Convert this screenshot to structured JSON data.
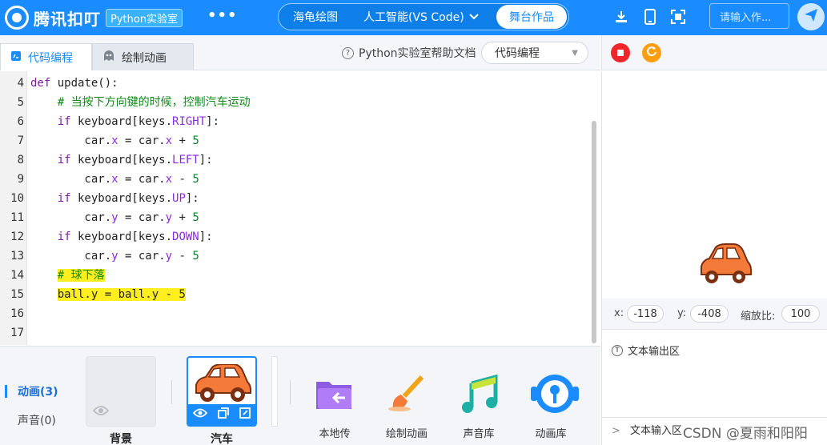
{
  "app": {
    "logo_text": "腾讯扣叮",
    "badge": "Python实验室",
    "more": "•••"
  },
  "mode_tabs": [
    {
      "label": "海龟绘图"
    },
    {
      "label": "人工智能(VS Code)"
    },
    {
      "label": "舞台作品"
    }
  ],
  "search": {
    "placeholder": "请输入作..."
  },
  "editor_tabs": {
    "code_tab": "代码编程",
    "draw_tab": "绘制动画",
    "help_link": "Python实验室帮助文档",
    "mode_select": "代码编程"
  },
  "code_lines": [
    {
      "n": "4",
      "tokens": [
        [
          "kw",
          "def"
        ],
        [
          "plain",
          " update():"
        ]
      ]
    },
    {
      "n": "5",
      "tokens": [
        [
          "cm",
          "    # 当按下方向键的时候，控制汽车运动"
        ]
      ]
    },
    {
      "n": "6",
      "tokens": [
        [
          "kw",
          "    if"
        ],
        [
          "plain",
          " keyboard[keys."
        ],
        [
          "at",
          "RIGHT"
        ],
        [
          "plain",
          "]:"
        ]
      ]
    },
    {
      "n": "7",
      "tokens": [
        [
          "plain",
          "        car."
        ],
        [
          "at",
          "x"
        ],
        [
          "plain",
          " = car."
        ],
        [
          "at",
          "x"
        ],
        [
          "plain",
          " + "
        ],
        [
          "num",
          "5"
        ]
      ]
    },
    {
      "n": "8",
      "tokens": [
        [
          "kw",
          "    if"
        ],
        [
          "plain",
          " keyboard[keys."
        ],
        [
          "at",
          "LEFT"
        ],
        [
          "plain",
          "]:"
        ]
      ]
    },
    {
      "n": "9",
      "tokens": [
        [
          "plain",
          "        car."
        ],
        [
          "at",
          "x"
        ],
        [
          "plain",
          " = car."
        ],
        [
          "at",
          "x"
        ],
        [
          "plain",
          " - "
        ],
        [
          "num",
          "5"
        ]
      ]
    },
    {
      "n": "10",
      "tokens": [
        [
          "kw",
          "    if"
        ],
        [
          "plain",
          " keyboard[keys."
        ],
        [
          "at",
          "UP"
        ],
        [
          "plain",
          "]:"
        ]
      ]
    },
    {
      "n": "11",
      "tokens": [
        [
          "plain",
          "        car."
        ],
        [
          "at",
          "y"
        ],
        [
          "plain",
          " = car."
        ],
        [
          "at",
          "y"
        ],
        [
          "plain",
          " + "
        ],
        [
          "num",
          "5"
        ]
      ]
    },
    {
      "n": "12",
      "tokens": [
        [
          "kw",
          "    if"
        ],
        [
          "plain",
          " keyboard[keys."
        ],
        [
          "at",
          "DOWN"
        ],
        [
          "plain",
          "]:"
        ]
      ]
    },
    {
      "n": "13",
      "tokens": [
        [
          "plain",
          "        car."
        ],
        [
          "at",
          "y"
        ],
        [
          "plain",
          " = car."
        ],
        [
          "at",
          "y"
        ],
        [
          "plain",
          " - "
        ],
        [
          "num",
          "5"
        ]
      ]
    },
    {
      "n": "14",
      "tokens": [
        [
          "plain",
          "    "
        ],
        [
          "cm-hl",
          "# 球下落"
        ]
      ]
    },
    {
      "n": "15",
      "tokens": [
        [
          "plain",
          "    "
        ],
        [
          "plain-hl",
          "ball.y = ball.y - 5"
        ]
      ]
    },
    {
      "n": "16",
      "tokens": []
    },
    {
      "n": "17",
      "tokens": []
    }
  ],
  "bottom_panel": {
    "tab_animation": "动画(3)",
    "tab_sound": "声音(0)",
    "sprite_bg": "背景",
    "sprite_car": "汽车",
    "libs": [
      {
        "label": "本地传"
      },
      {
        "label": "绘制动画"
      },
      {
        "label": "声音库"
      },
      {
        "label": "动画库"
      }
    ]
  },
  "stage": {
    "x_label": "x:",
    "x_value": "-118",
    "y_label": "y:",
    "y_value": "-408",
    "scale_label": "缩放比:",
    "scale_value": "100",
    "output_title": "文本输出区",
    "input_title": "文本输入区"
  },
  "watermark": "CSDN @夏雨和阳阳",
  "colors": {
    "brand": "#1a8cff",
    "stop": "#f0262a",
    "restart": "#ff9f0f",
    "highlight": "#ffef21"
  }
}
